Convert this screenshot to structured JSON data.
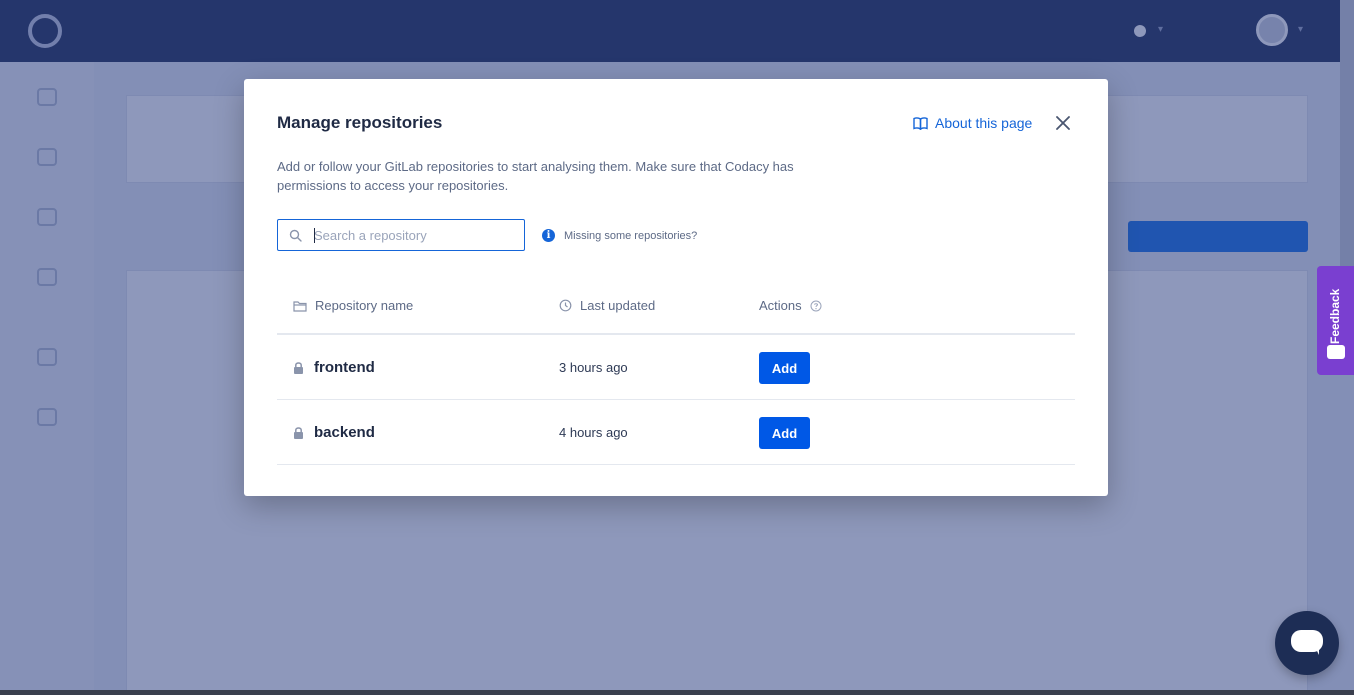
{
  "modal": {
    "title": "Manage repositories",
    "about_link": "About this page",
    "description": "Add or follow your GitLab repositories to start analysing them. Make sure that Codacy has permissions to access your repositories.",
    "search": {
      "placeholder": "Search a repository",
      "value": ""
    },
    "missing_link": "Missing some repositories?",
    "columns": {
      "name": "Repository name",
      "updated": "Last updated",
      "actions": "Actions"
    },
    "rows": [
      {
        "name": "frontend",
        "updated": "3 hours ago",
        "action": "Add"
      },
      {
        "name": "backend",
        "updated": "4 hours ago",
        "action": "Add"
      }
    ]
  },
  "feedback": {
    "label": "Feedback"
  },
  "colors": {
    "primary": "#0058e6",
    "link": "#1565d8",
    "feedback": "#7a3fd0",
    "chat": "#1d2d55"
  }
}
